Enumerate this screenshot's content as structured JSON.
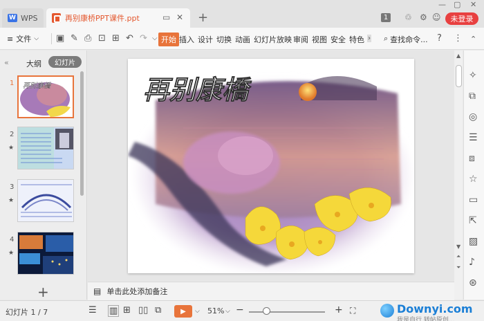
{
  "titlebar": {
    "wps_label": "WPS",
    "doc_title": "再别康桥PPT课件.ppt",
    "badge": "1",
    "login_label": "未登录"
  },
  "toolbar": {
    "file_label": "文件",
    "tabs": [
      "开始",
      "插入",
      "设计",
      "切换",
      "动画",
      "幻灯片放映",
      "审阅",
      "视图",
      "安全",
      "特色"
    ],
    "search_label": "查找命令..."
  },
  "left_panel": {
    "tab_outline": "大纲",
    "tab_slides": "幻灯片",
    "slides": [
      {
        "num": "1",
        "starred": false
      },
      {
        "num": "2",
        "starred": true
      },
      {
        "num": "3",
        "starred": true
      },
      {
        "num": "4",
        "starred": true
      }
    ]
  },
  "slide": {
    "title": "再别康橋"
  },
  "notes": {
    "placeholder": "单击此处添加备注"
  },
  "statusbar": {
    "slide_count": "幻灯片 1 / 7",
    "zoom": "51%"
  },
  "watermark": {
    "brand": "Downyi.com",
    "sub": "我是自行   转帖原创..."
  },
  "colors": {
    "accent": "#e8743b",
    "login": "#e84040",
    "doc_tab_text": "#e4572e"
  }
}
